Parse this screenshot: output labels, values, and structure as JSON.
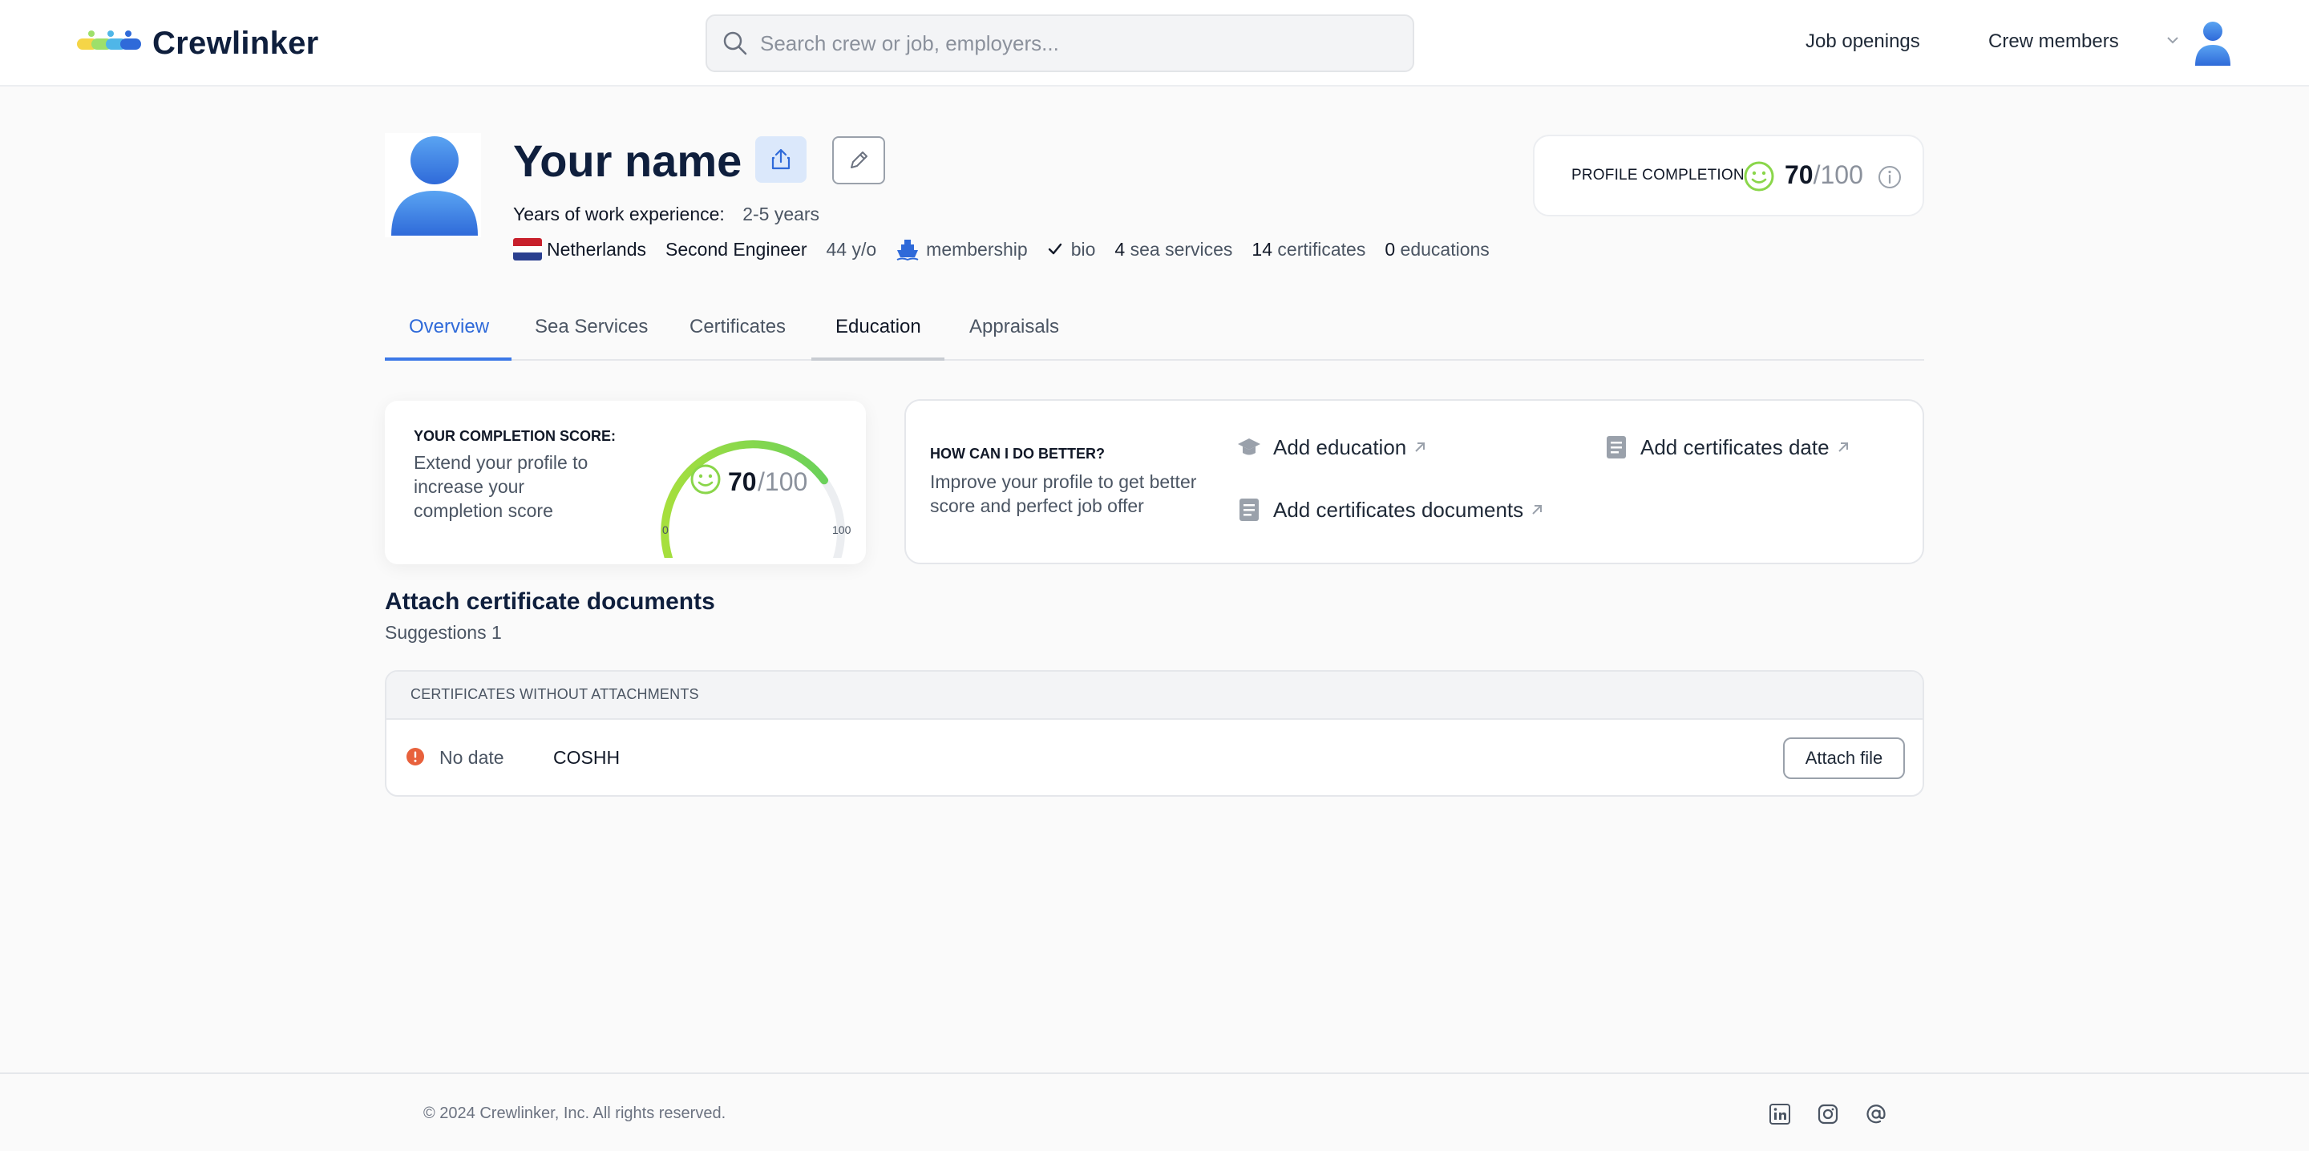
{
  "header": {
    "brand": "Crewlinker",
    "search_placeholder": "Search crew or job, employers...",
    "nav": {
      "jobs": "Job openings",
      "crew": "Crew members"
    }
  },
  "profile": {
    "name": "Your name",
    "experience_label": "Years of work experience:",
    "experience_value": "2-5 years",
    "country": "Netherlands",
    "rank": "Second Engineer",
    "age": "44 y/o",
    "membership": "membership",
    "bio": "bio",
    "sea_services_count": "4",
    "sea_services_label": "sea services",
    "certificates_count": "14",
    "certificates_label": "certificates",
    "educations_count": "0",
    "educations_label": "educations"
  },
  "completion": {
    "label": "PROFILE COMPLETION",
    "score": "70",
    "max": "/100",
    "score_fraction": 0.7
  },
  "tabs": [
    {
      "label": "Overview"
    },
    {
      "label": "Sea Services"
    },
    {
      "label": "Certificates"
    },
    {
      "label": "Education"
    },
    {
      "label": "Appraisals"
    }
  ],
  "score_card": {
    "title": "YOUR COMPLETION SCORE:",
    "description": "Extend your profile to increase your completion score",
    "score": "70",
    "max": "/100",
    "min_label": "0",
    "max_label": "100"
  },
  "better": {
    "title": "HOW CAN I DO BETTER?",
    "description": "Improve your profile to get better score and perfect job offer",
    "items": [
      {
        "label": "Add education",
        "icon": "graduation-cap-icon"
      },
      {
        "label": "Add certificates date",
        "icon": "document-icon"
      },
      {
        "label": "Add certificates documents",
        "icon": "document-icon"
      }
    ]
  },
  "attach": {
    "title": "Attach certificate documents",
    "suggestions": "Suggestions 1",
    "table_header": "CERTIFICATES WITHOUT ATTACHMENTS",
    "rows": [
      {
        "date": "No date",
        "name": "COSHH",
        "action": "Attach file"
      }
    ]
  },
  "footer": {
    "copyright": "© 2024 Crewlinker, Inc. All rights reserved."
  },
  "colors": {
    "accent": "#3b78e7",
    "brand_navy": "#0f1f3d",
    "gauge_green": "#8ad64a",
    "warning": "#e8613c"
  }
}
